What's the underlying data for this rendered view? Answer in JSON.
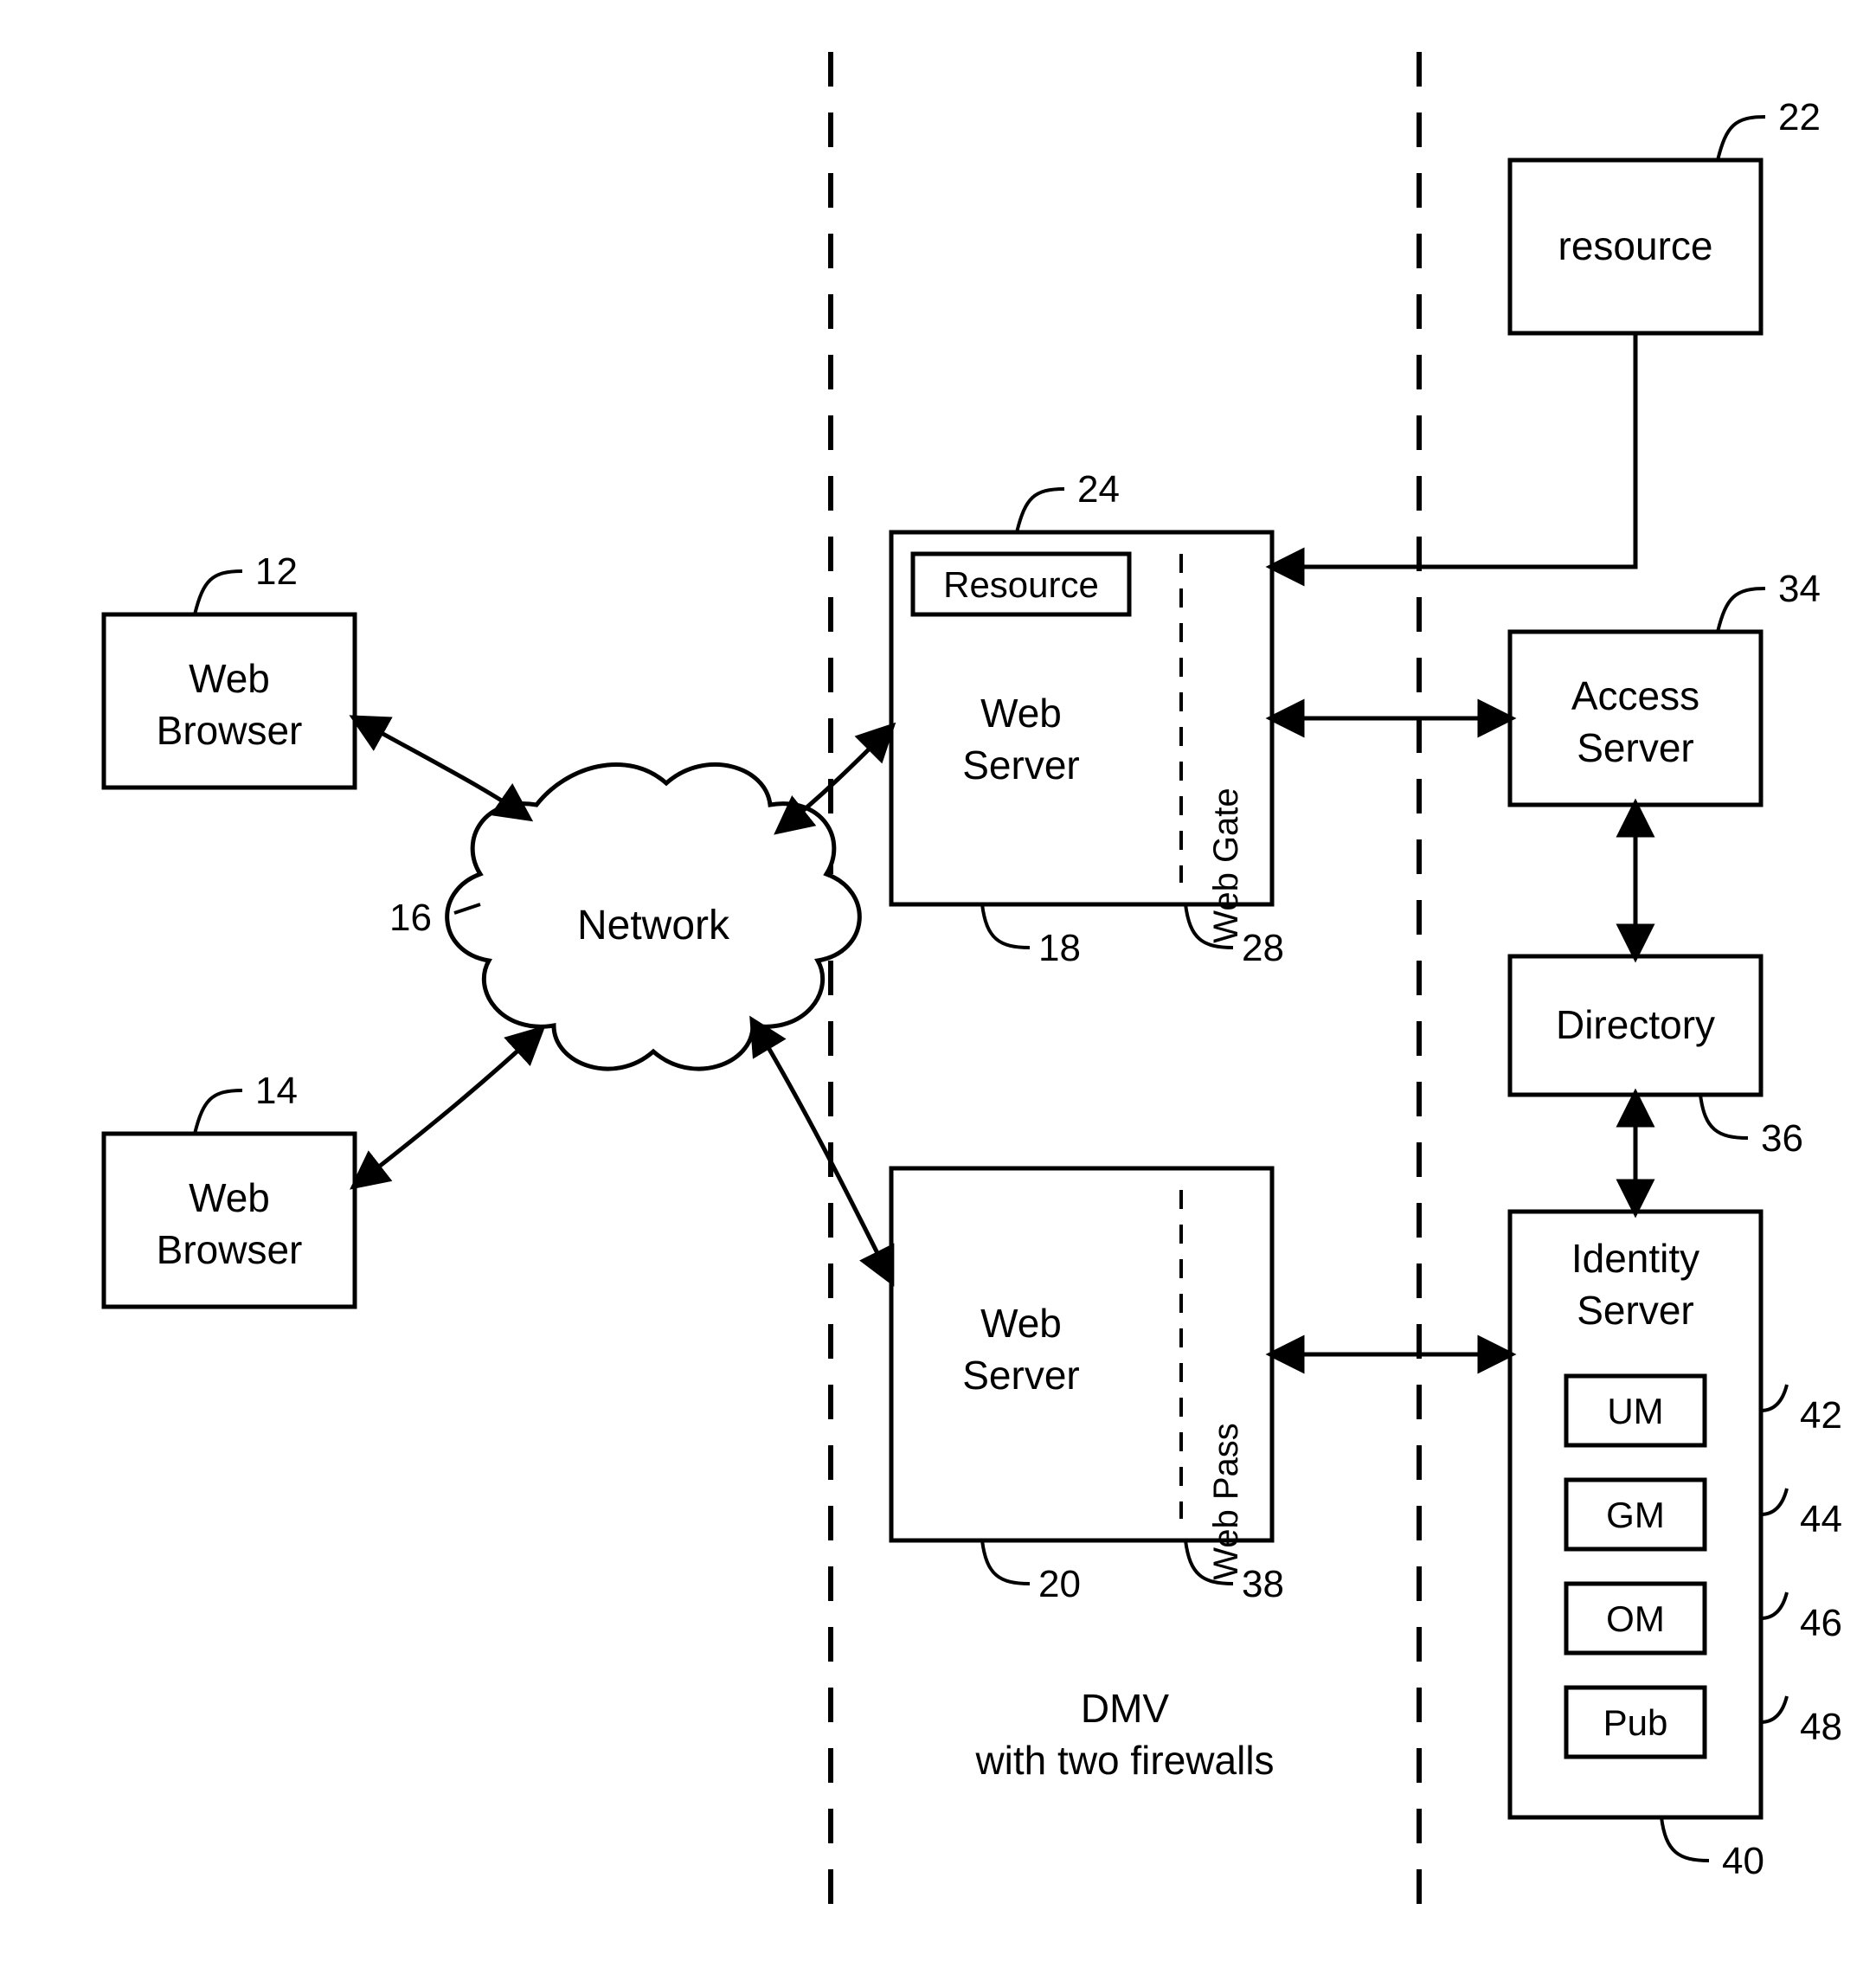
{
  "nodes": {
    "browser1": {
      "label_line1": "Web",
      "label_line2": "Browser",
      "ref": "12"
    },
    "browser2": {
      "label_line1": "Web",
      "label_line2": "Browser",
      "ref": "14"
    },
    "network": {
      "label": "Network",
      "ref": "16"
    },
    "webserver1": {
      "label_line1": "Web",
      "label_line2": "Server",
      "ref": "18"
    },
    "webserver1_inner": {
      "label": "Resource",
      "ref": "24"
    },
    "webgate": {
      "label": "Web Gate",
      "ref": "28"
    },
    "webserver2": {
      "label_line1": "Web",
      "label_line2": "Server",
      "ref": "20"
    },
    "webpass": {
      "label": "Web Pass",
      "ref": "38"
    },
    "resource": {
      "label": "resource",
      "ref": "22"
    },
    "access": {
      "label_line1": "Access",
      "label_line2": "Server",
      "ref": "34"
    },
    "directory": {
      "label": "Directory",
      "ref": "36"
    },
    "identity": {
      "label_line1": "Identity",
      "label_line2": "Server",
      "ref": "40"
    },
    "um": {
      "label": "UM",
      "ref": "42"
    },
    "gm": {
      "label": "GM",
      "ref": "44"
    },
    "om": {
      "label": "OM",
      "ref": "46"
    },
    "pub": {
      "label": "Pub",
      "ref": "48"
    }
  },
  "caption_line1": "DMV",
  "caption_line2": "with  two firewalls"
}
